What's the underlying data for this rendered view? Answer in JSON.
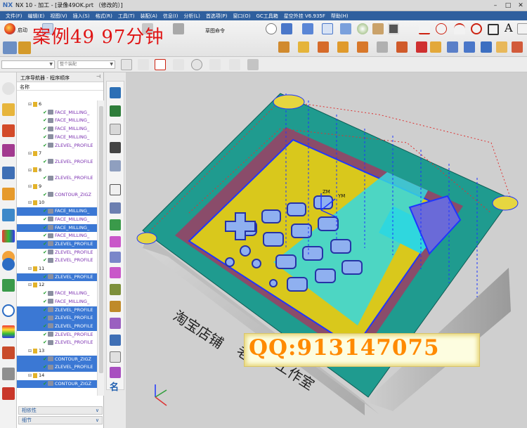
{
  "titlebar": {
    "logo": "NX",
    "title": "NX 10 - 加工 - [录像49OK.prt （修改的）]",
    "minimize": "–",
    "maximize": "□",
    "close": "✕"
  },
  "menu": [
    {
      "label": "文件(F)"
    },
    {
      "label": "编辑(E)"
    },
    {
      "label": "视图(V)"
    },
    {
      "label": "插入(S)"
    },
    {
      "label": "格式(R)"
    },
    {
      "label": "工具(T)"
    },
    {
      "label": "装配(A)"
    },
    {
      "label": "信息(I)"
    },
    {
      "label": "分析(L)"
    },
    {
      "label": "首选项(P)"
    },
    {
      "label": "窗口(O)"
    },
    {
      "label": "GC工具箱"
    },
    {
      "label": "星空外挂 V6.935F"
    },
    {
      "label": "帮助(H)"
    }
  ],
  "ribbon": {
    "start_label": "启动",
    "overlay_title": "案例49  97分钟",
    "sketch_label": "草图命令",
    "font_letter": "A"
  },
  "selection_bar": {
    "filter_value": "",
    "scope_value": "整个装配"
  },
  "navigator": {
    "title": "工序导航器 - 程序顺序",
    "column_name": "名称",
    "rows": [
      {
        "type": "group",
        "label": "6",
        "selected": false
      },
      {
        "type": "op",
        "label": "FACE_MILLING_",
        "selected": false
      },
      {
        "type": "op",
        "label": "FACE_MILLING_",
        "selected": false
      },
      {
        "type": "op",
        "label": "FACE_MILLING_",
        "selected": false
      },
      {
        "type": "op",
        "label": "FACE_MILLING_",
        "selected": false
      },
      {
        "type": "op",
        "label": "ZLEVEL_PROFILE",
        "selected": false
      },
      {
        "type": "group",
        "label": "7",
        "selected": false
      },
      {
        "type": "op",
        "label": "ZLEVEL_PROFILE",
        "selected": false
      },
      {
        "type": "group",
        "label": "8",
        "selected": false
      },
      {
        "type": "op",
        "label": "ZLEVEL_PROFILE",
        "selected": false
      },
      {
        "type": "group",
        "label": "9",
        "selected": false
      },
      {
        "type": "op",
        "label": "CONTOUR_ZIGZ",
        "selected": false
      },
      {
        "type": "group",
        "label": "10",
        "selected": false
      },
      {
        "type": "op",
        "label": "FACE_MILLING_",
        "selected": true
      },
      {
        "type": "op",
        "label": "FACE_MILLING_",
        "selected": false
      },
      {
        "type": "op",
        "label": "FACE_MILLING_",
        "selected": true
      },
      {
        "type": "op",
        "label": "FACE_MILLING_",
        "selected": false
      },
      {
        "type": "op",
        "label": "ZLEVEL_PROFILE",
        "selected": true
      },
      {
        "type": "op",
        "label": "ZLEVEL_PROFILE",
        "selected": false
      },
      {
        "type": "op",
        "label": "ZLEVEL_PROFILE",
        "selected": false
      },
      {
        "type": "group",
        "label": "11",
        "selected": false
      },
      {
        "type": "op",
        "label": "ZLEVEL_PROFILE",
        "selected": true
      },
      {
        "type": "group",
        "label": "12",
        "selected": false
      },
      {
        "type": "op",
        "label": "FACE_MILLING_",
        "selected": false
      },
      {
        "type": "op",
        "label": "FACE_MILLING_",
        "selected": false
      },
      {
        "type": "op",
        "label": "ZLEVEL_PROFILE",
        "selected": true
      },
      {
        "type": "op",
        "label": "ZLEVEL_PROFILE",
        "selected": true
      },
      {
        "type": "op",
        "label": "ZLEVEL_PROFILE",
        "selected": true
      },
      {
        "type": "op",
        "label": "ZLEVEL_PROFILE",
        "selected": false
      },
      {
        "type": "op",
        "label": "ZLEVEL_PROFILE",
        "selected": false
      },
      {
        "type": "group",
        "label": "13",
        "selected": false
      },
      {
        "type": "op",
        "label": "CONTOUR_ZIGZ",
        "selected": true
      },
      {
        "type": "op",
        "label": "ZLEVEL_PROFILE",
        "selected": true
      },
      {
        "type": "group",
        "label": "14",
        "selected": false
      },
      {
        "type": "op",
        "label": "CONTOUR_ZIGZ",
        "selected": true
      }
    ],
    "footer_dependencies": "相依性",
    "footer_details": "细节"
  },
  "viewport": {
    "engraved_text_1": "淘宝店铺",
    "engraved_text_2": "老",
    "engraved_text_3": "工作室",
    "axis_zm": "ZM",
    "axis_ym": "YM",
    "colors": {
      "background": "#cfcfcf",
      "top_face": "#1f9b8f",
      "cavity_floor": "#d9c81c",
      "toolpath": "#1e36ff",
      "pocket_wall": "#8a4c6a",
      "side_wall": "#b8b8b8"
    }
  },
  "watermark": {
    "qq": "QQ:913147075"
  },
  "colors": {
    "menubar": "#2f5f9e",
    "selection": "#3b78d4",
    "title_red": "#e01414",
    "watermark_orange": "#ff8a00"
  }
}
